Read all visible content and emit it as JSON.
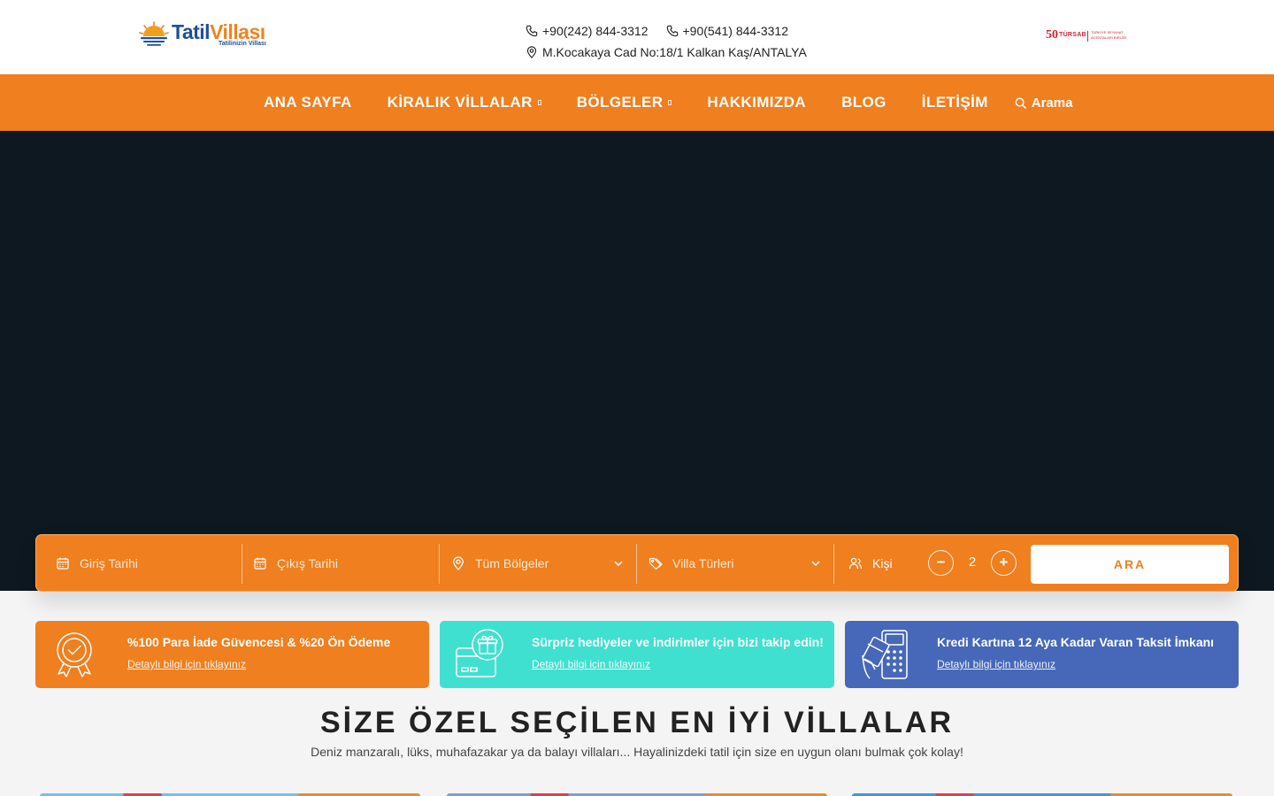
{
  "header": {
    "logo": {
      "brand_part1": "Tatil",
      "brand_part2": "Villası",
      "tagline": "Tatilinizin Villası"
    },
    "phones": [
      "+90(242) 844-3312",
      "+90(541) 844-3312"
    ],
    "address": "M.Kocakaya Cad No:18/1 Kalkan Kaş/ANTALYA",
    "tursab": {
      "number": "50",
      "name": "TÜRSAB",
      "desc": "TÜRKİYE SEYAHAT ACENTALARI BİRLİĞİ"
    }
  },
  "nav": {
    "items": [
      {
        "label": "ANA SAYFA"
      },
      {
        "label": "KİRALIK VİLLALAR",
        "dropdown": true
      },
      {
        "label": "BÖLGELER",
        "dropdown": true
      },
      {
        "label": "HAKKIMIZDA"
      },
      {
        "label": "BLOG"
      },
      {
        "label": "İLETİŞİM"
      }
    ],
    "search_label": "Arama"
  },
  "search": {
    "checkin_placeholder": "Giriş Tarihi",
    "checkout_placeholder": "Çıkış Tarihi",
    "region_value": "Tüm Bölgeler",
    "type_value": "Villa Türleri",
    "people_label": "Kişi",
    "minus": "−",
    "plus": "+",
    "people_count": "2",
    "submit_label": "ARA"
  },
  "features": [
    {
      "title": "%100 Para İade Güvencesi & %20 Ön Ödeme",
      "link": "Detaylı bilgi için tıklayınız",
      "color": "#ef7f1f",
      "icon": "award-check-icon"
    },
    {
      "title": "Sürpriz hediyeler ve indirimler için bizi takip edin!",
      "link": "Detaylı bilgi için tıklayınız",
      "color": "#40e0d0",
      "icon": "gift-card-icon"
    },
    {
      "title": "Kredi Kartına 12 Aya Kadar Varan Taksit İmkanı",
      "link": "Detaylı bilgi için tıklayınız",
      "color": "#4768b8",
      "icon": "card-terminal-icon"
    }
  ],
  "section": {
    "title": "SİZE ÖZEL SEÇİLEN EN İYİ VİLLALAR",
    "subtitle": "Deniz manzaralı, lüks, muhafazakar ya da balayı villaları... Hayalinizdeki tatil için size en uygun olanı bulmak çok kolay!"
  },
  "colors": {
    "accent": "#ef7f1f",
    "hero_bg": "#0d1821",
    "teal": "#40e0d0",
    "blue": "#4768b8"
  }
}
